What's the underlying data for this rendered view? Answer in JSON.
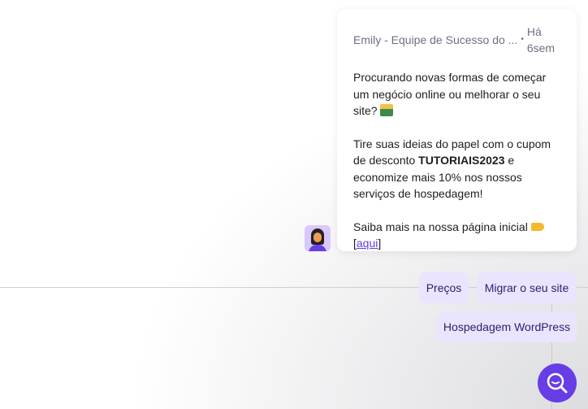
{
  "message": {
    "sender": "Emily - Equipe de Sucesso do ...",
    "separator": "•",
    "time": "Há 6sem",
    "line1": "Procurando novas formas de começar um negócio online ou melhorar o seu site?",
    "line2_pre": "Tire suas ideias do papel com o cupom de desconto ",
    "coupon": "TUTORIAIS2023",
    "line2_post": " e economize mais 10% nos nossos serviços de hospedagem!",
    "line3": "Saiba mais na nossa página inicial",
    "link_open": "[",
    "link": "aqui",
    "link_close": "]"
  },
  "quick_replies": [
    {
      "label": "Preços"
    },
    {
      "label": "Migrar o seu site"
    },
    {
      "label": "Hospedagem WordPress"
    }
  ],
  "colors": {
    "accent": "#673de6",
    "chip_bg": "#ebe4ff"
  }
}
